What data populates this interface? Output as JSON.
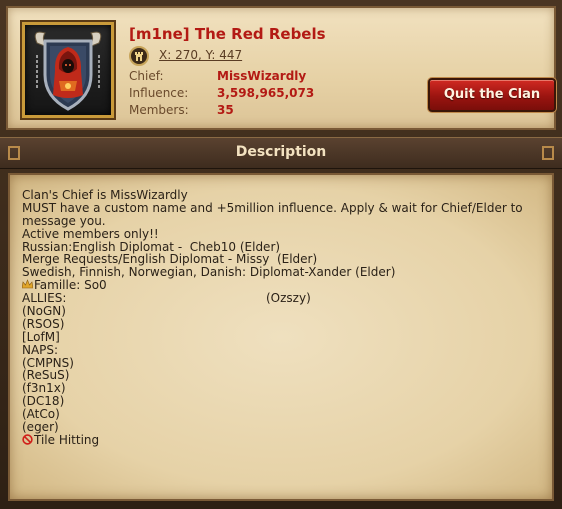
{
  "clan": {
    "name": "[m1ne] The Red Rebels",
    "coordinates": "X: 270, Y: 447",
    "chief_label": "Chief:",
    "chief_value": "MissWizardly",
    "influence_label": "Influence:",
    "influence_value": "3,598,965,073",
    "members_label": "Members:",
    "members_value": "35"
  },
  "actions": {
    "quit_label": "Quit the Clan"
  },
  "description": {
    "title": "Description",
    "lines": [
      "Clan's Chief is MissWizardly",
      "MUST have a custom name and +5million influence. Apply & wait for Chief/Elder to message you.",
      "Active members only!!",
      "Russian:English Diplomat -  Cheb10 (Elder)",
      "Merge Requests/English Diplomat - Missy  (Elder)",
      "Swedish, Finnish, Norwegian, Danish: Diplomat-Xander (Elder)",
      "Famille: So0",
      "ALLIES:",
      "(Ozszy)",
      "(NoGN)",
      "(RSOS)",
      "[LofM]",
      "NAPS:",
      "(CMPNS)",
      "(ReSuS)",
      "(f3n1x)",
      "(DC18)",
      "(AtCo)",
      "(eger)",
      "Tile Hitting"
    ]
  },
  "icons": {
    "emblem": "hooded-figure-shield-emblem",
    "coords": "castle-tower-icon",
    "famille": "crown-icon",
    "tile_hitting": "no-entry-icon"
  },
  "colors": {
    "accent_red": "#b31a14",
    "button_red": "#9a1410",
    "parchment": "#e6d2a7"
  }
}
